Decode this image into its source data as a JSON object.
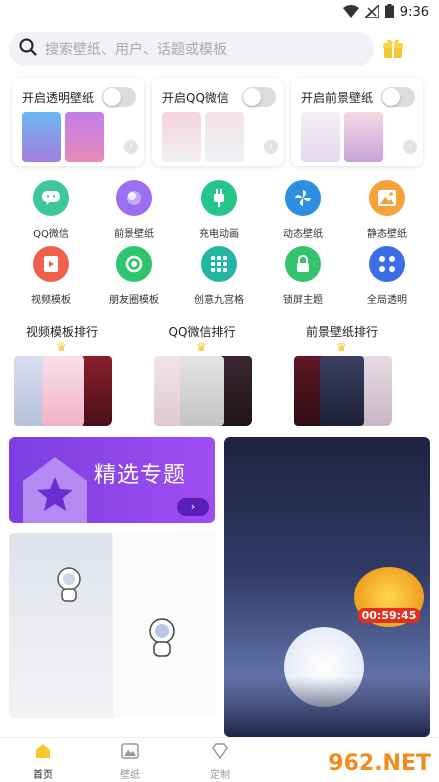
{
  "status": {
    "time": "9:36"
  },
  "search": {
    "placeholder": "搜索壁纸、用户、话题或模板"
  },
  "toggles": [
    {
      "label": "开启透明壁纸"
    },
    {
      "label": "开启QQ微信"
    },
    {
      "label": "开启前景壁纸"
    }
  ],
  "grid": [
    {
      "label": "QQ微信",
      "icon": "chat-icon",
      "color": "#3dc79a"
    },
    {
      "label": "前景壁纸",
      "icon": "layer-icon",
      "color": "#9b6ff0"
    },
    {
      "label": "充电动画",
      "icon": "plug-icon",
      "color": "#25c58c"
    },
    {
      "label": "动态壁纸",
      "icon": "pinwheel-icon",
      "color": "#2e8fe0"
    },
    {
      "label": "静态壁纸",
      "icon": "image-icon",
      "color": "#f5a23a"
    },
    {
      "label": "视频模板",
      "icon": "film-icon",
      "color": "#f0604e"
    },
    {
      "label": "朋友圈模板",
      "icon": "camera-icon",
      "color": "#2fc56e"
    },
    {
      "label": "创意九宫格",
      "icon": "grid-icon",
      "color": "#23b5a4"
    },
    {
      "label": "锁屏主题",
      "icon": "lock-icon",
      "color": "#35c36e"
    },
    {
      "label": "全局透明",
      "icon": "dots-icon",
      "color": "#3b6de6"
    }
  ],
  "rankings": [
    {
      "label": "视频模板排行"
    },
    {
      "label": "QQ微信排行"
    },
    {
      "label": "前景壁纸排行"
    }
  ],
  "featured": {
    "label": "精选专题",
    "button": "›"
  },
  "timer": {
    "text": "00:59:45"
  },
  "nav": [
    {
      "label": "首页",
      "active": true
    },
    {
      "label": "壁纸",
      "active": false
    },
    {
      "label": "定制",
      "active": false
    }
  ],
  "watermark": {
    "text": "962.NET"
  }
}
